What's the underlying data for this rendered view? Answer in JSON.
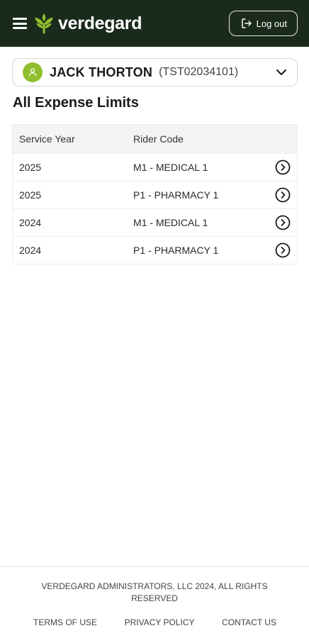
{
  "header": {
    "brand_name": "verdegard",
    "logout_label": "Log out"
  },
  "member": {
    "name": "JACK THORTON",
    "id": "(TST02034101)"
  },
  "page_title": "All Expense Limits",
  "table": {
    "headers": {
      "service_year": "Service Year",
      "rider_code": "Rider Code"
    },
    "rows": [
      {
        "service_year": "2025",
        "rider_code": "M1 - MEDICAL 1"
      },
      {
        "service_year": "2025",
        "rider_code": "P1 - PHARMACY 1"
      },
      {
        "service_year": "2024",
        "rider_code": "M1 - MEDICAL 1"
      },
      {
        "service_year": "2024",
        "rider_code": "P1 - PHARMACY 1"
      }
    ]
  },
  "footer": {
    "copyright": "VERDEGARD ADMINISTRATORS, LLC 2024, ALL RIGHTS RESERVED",
    "links": {
      "terms": "TERMS OF USE",
      "privacy": "PRIVACY POLICY",
      "contact": "CONTACT US"
    }
  },
  "colors": {
    "header_bg": "#1a2b1c",
    "brand_accent": "#8fbf2f"
  },
  "icons": [
    "menu-icon",
    "leaf-logo-icon",
    "logout-icon",
    "user-icon",
    "chevron-down-icon",
    "chevron-right-circle-icon"
  ]
}
